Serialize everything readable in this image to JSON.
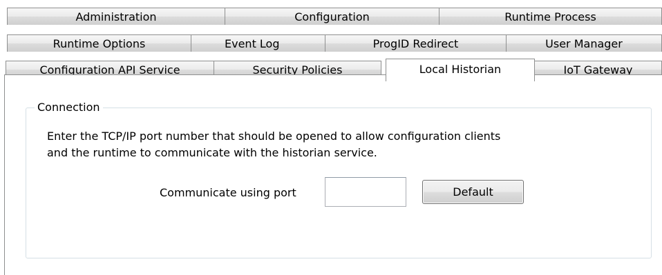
{
  "tabs": {
    "row1": [
      {
        "label": "Administration"
      },
      {
        "label": "Configuration"
      },
      {
        "label": "Runtime Process"
      }
    ],
    "row2": [
      {
        "label": "Runtime Options"
      },
      {
        "label": "Event Log"
      },
      {
        "label": "ProgID Redirect"
      },
      {
        "label": "User Manager"
      }
    ],
    "row3": [
      {
        "label": "Configuration API Service"
      },
      {
        "label": "Security Policies"
      },
      {
        "label": "Local Historian",
        "active": true
      },
      {
        "label": "IoT Gateway"
      }
    ]
  },
  "connection": {
    "legend": "Connection",
    "description_line1": "Enter the TCP/IP port number that should be opened to allow configuration clients",
    "description_line2": "and the runtime to communicate with the historian service.",
    "port_label": "Communicate using port",
    "port_value": "",
    "default_button": "Default"
  }
}
